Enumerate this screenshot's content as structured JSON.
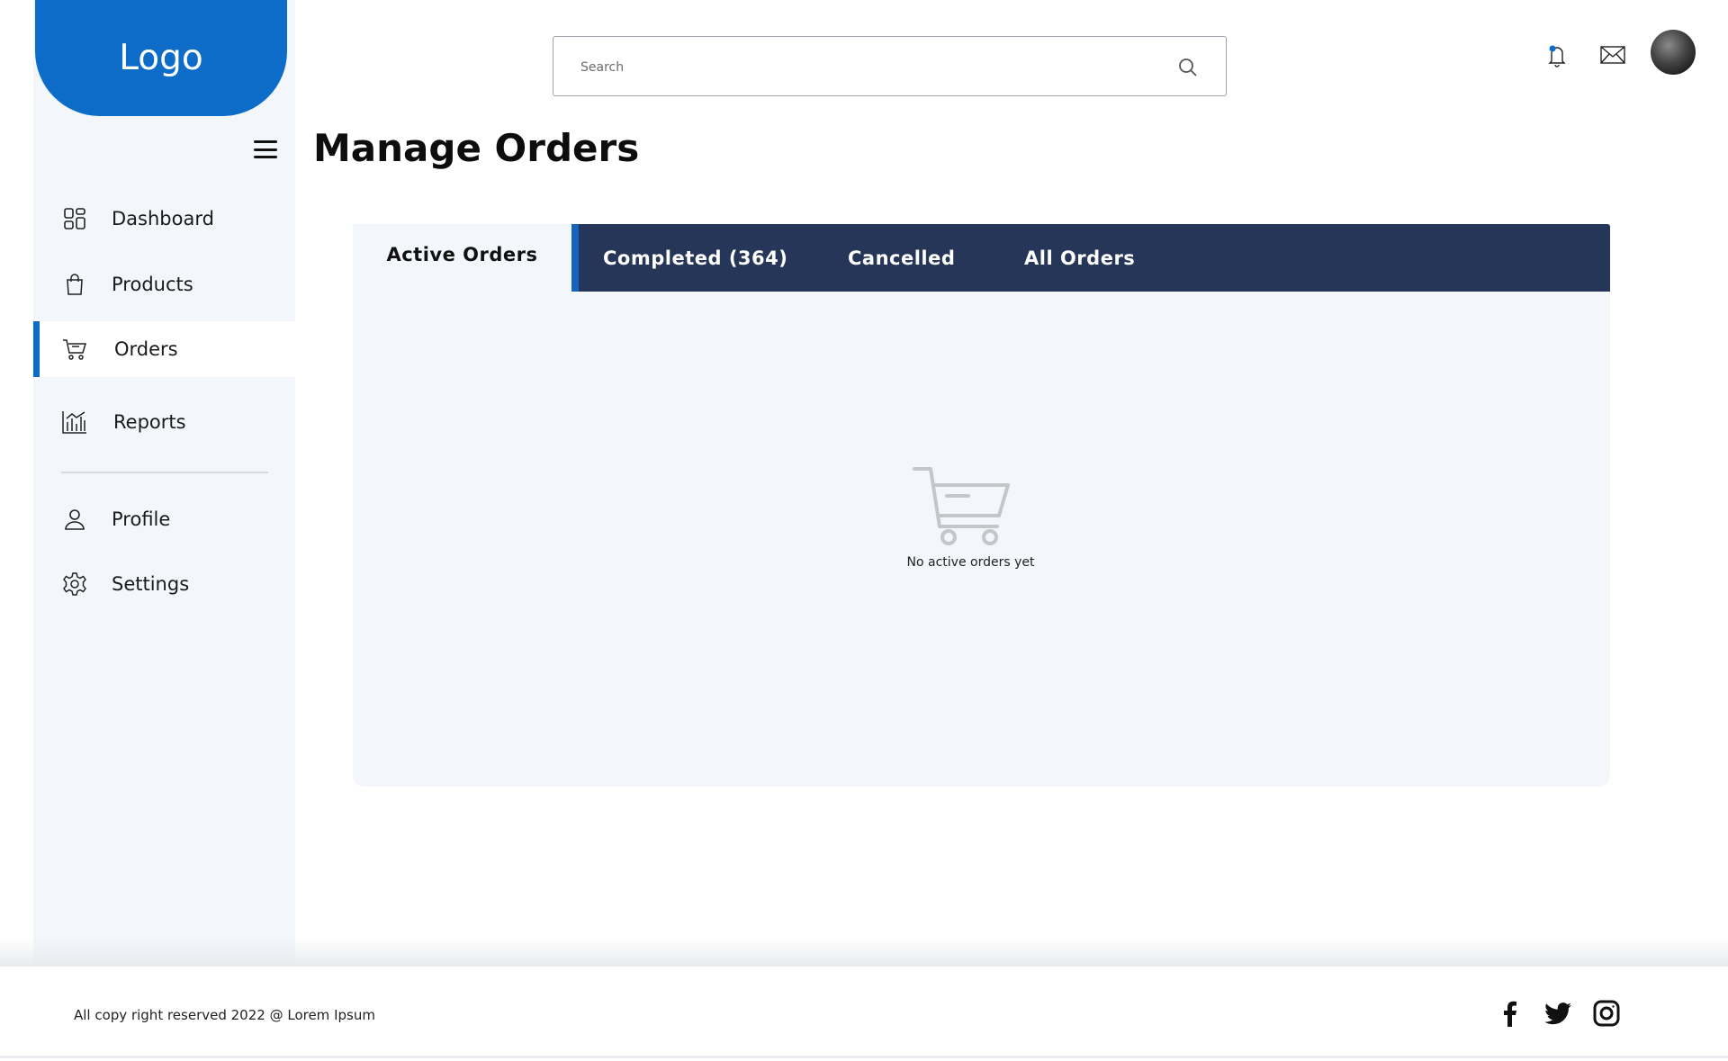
{
  "brand": {
    "logo_text": "Logo"
  },
  "sidebar": {
    "items": [
      {
        "label": "Dashboard",
        "icon": "dashboard-icon"
      },
      {
        "label": "Products",
        "icon": "shopping-bag-icon"
      },
      {
        "label": "Orders",
        "icon": "cart-icon",
        "active": true
      },
      {
        "label": "Reports",
        "icon": "bar-chart-icon"
      },
      {
        "label": "Profile",
        "icon": "user-icon"
      },
      {
        "label": "Settings",
        "icon": "gear-icon"
      }
    ]
  },
  "header": {
    "search_placeholder": "Search",
    "icons": [
      "bell-icon",
      "mail-icon",
      "avatar"
    ]
  },
  "main": {
    "title": "Manage Orders",
    "tabs": [
      {
        "label": "Active Orders",
        "active": true
      },
      {
        "label": "Completed (364)"
      },
      {
        "label": "Cancelled"
      },
      {
        "label": "All Orders"
      }
    ],
    "empty_state": {
      "icon": "empty-cart-icon",
      "message": "No active orders yet"
    }
  },
  "footer": {
    "copyright": "All copy right reserved 2022 @ Lorem Ipsum",
    "social": [
      "facebook-icon",
      "twitter-icon",
      "instagram-icon"
    ]
  },
  "colors": {
    "accent": "#0d6cc8",
    "tab_bar": "#253659",
    "panel_bg": "#f3f6fb"
  }
}
